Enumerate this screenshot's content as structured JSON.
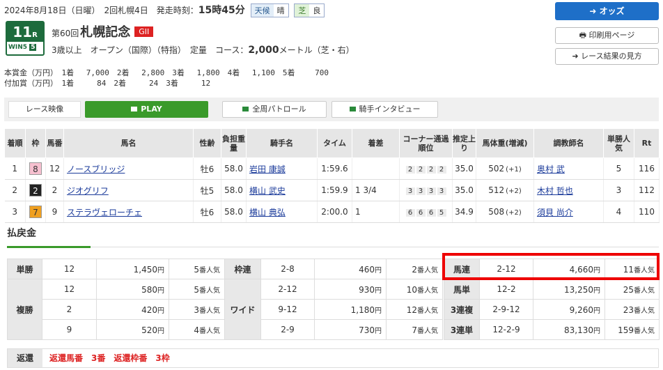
{
  "header": {
    "date": "2024年8月18日（日曜）",
    "meeting": "2回札幌4日",
    "start_label": "発走時刻：",
    "start_time": "15時45分",
    "weather_label": "天候",
    "weather": "晴",
    "turf_label": "芝",
    "going": "良"
  },
  "race": {
    "number": "11",
    "r": "R",
    "win5": "WIN5",
    "win5_num": "5",
    "kai": "第60回",
    "name": "札幌記念",
    "grade": "GII",
    "conditions": "3歳以上　オープン（国際）（特指）　定量",
    "course_label": "コース：",
    "distance": "2,000",
    "course_unit": "メートル（芝・右）"
  },
  "buttons": {
    "odds": "オッズ",
    "print": "印刷用ページ",
    "guide": "レース結果の見方"
  },
  "prize": {
    "line1": "本賞金（万円）　1着　 7,000　2着　 2,800　3着　 1,800　4着　 1,100　5着　　 700",
    "line2": "付加賞（万円）　1着　　　84　2着　　　24　3着　　　12"
  },
  "video": {
    "label": "レース映像",
    "play": "PLAY",
    "patrol": "全周パトロール",
    "interview": "騎手インタビュー"
  },
  "results": {
    "headers": [
      "着順",
      "枠",
      "馬番",
      "馬名",
      "性齢",
      "負担重量",
      "騎手名",
      "タイム",
      "着差",
      "コーナー通過順位",
      "推定上り",
      "馬体重(増減)",
      "調教師名",
      "単勝人気",
      "Rt"
    ],
    "rows": [
      {
        "rank": "1",
        "waku": "8",
        "num": "12",
        "horse": "ノースブリッジ",
        "sex": "牡6",
        "wt": "58.0",
        "jockey": "岩田 康誠",
        "time": "1:59.6",
        "margin": "",
        "corner": [
          "2",
          "2",
          "2",
          "2"
        ],
        "agari": "35.0",
        "bw": "502",
        "bwd": "(+1)",
        "trainer": "奥村 武",
        "pop": "5",
        "rt": "116"
      },
      {
        "rank": "2",
        "waku": "2",
        "num": "2",
        "horse": "ジオグリフ",
        "sex": "牡5",
        "wt": "58.0",
        "jockey": "横山 武史",
        "time": "1:59.9",
        "margin": "1 3/4",
        "corner": [
          "3",
          "3",
          "3",
          "3"
        ],
        "agari": "35.0",
        "bw": "512",
        "bwd": "(+2)",
        "trainer": "木村 哲也",
        "pop": "3",
        "rt": "112"
      },
      {
        "rank": "3",
        "waku": "7",
        "num": "9",
        "horse": "ステラヴェローチェ",
        "sex": "牡6",
        "wt": "58.0",
        "jockey": "横山 典弘",
        "time": "2:00.0",
        "margin": "1",
        "corner": [
          "6",
          "6",
          "6",
          "5"
        ],
        "agari": "34.9",
        "bw": "508",
        "bwd": "(+2)",
        "trainer": "須貝 尚介",
        "pop": "4",
        "rt": "110"
      }
    ]
  },
  "payout": {
    "title": "払戻金",
    "yen": "円",
    "ninki": "番人気",
    "tan": {
      "label": "単勝",
      "rows": [
        {
          "n": "12",
          "p": "1,450",
          "pop": "5"
        }
      ]
    },
    "fuku": {
      "label": "複勝",
      "rows": [
        {
          "n": "12",
          "p": "580",
          "pop": "5"
        },
        {
          "n": "2",
          "p": "420",
          "pop": "3"
        },
        {
          "n": "9",
          "p": "520",
          "pop": "4"
        }
      ]
    },
    "waku": {
      "label": "枠連",
      "rows": [
        {
          "n": "2-8",
          "p": "460",
          "pop": "2"
        }
      ]
    },
    "wide": {
      "label": "ワイド",
      "rows": [
        {
          "n": "2-12",
          "p": "930",
          "pop": "10"
        },
        {
          "n": "9-12",
          "p": "1,180",
          "pop": "12"
        },
        {
          "n": "2-9",
          "p": "730",
          "pop": "7"
        }
      ]
    },
    "right": [
      {
        "label": "馬連",
        "n": "2-12",
        "p": "4,660",
        "pop": "11"
      },
      {
        "label": "馬単",
        "n": "12-2",
        "p": "13,250",
        "pop": "25"
      },
      {
        "label": "3連複",
        "n": "2-9-12",
        "p": "9,260",
        "pop": "23"
      },
      {
        "label": "3連単",
        "n": "12-2-9",
        "p": "83,130",
        "pop": "159"
      }
    ],
    "henkan": {
      "label": "返還",
      "value": "返還馬番　3番　返還枠番　3枠"
    }
  },
  "colors": {
    "highlight": "#ee0000",
    "accent": "#1d6b3c",
    "play": "#3a9a2a",
    "odds": "#1e6fc8"
  }
}
